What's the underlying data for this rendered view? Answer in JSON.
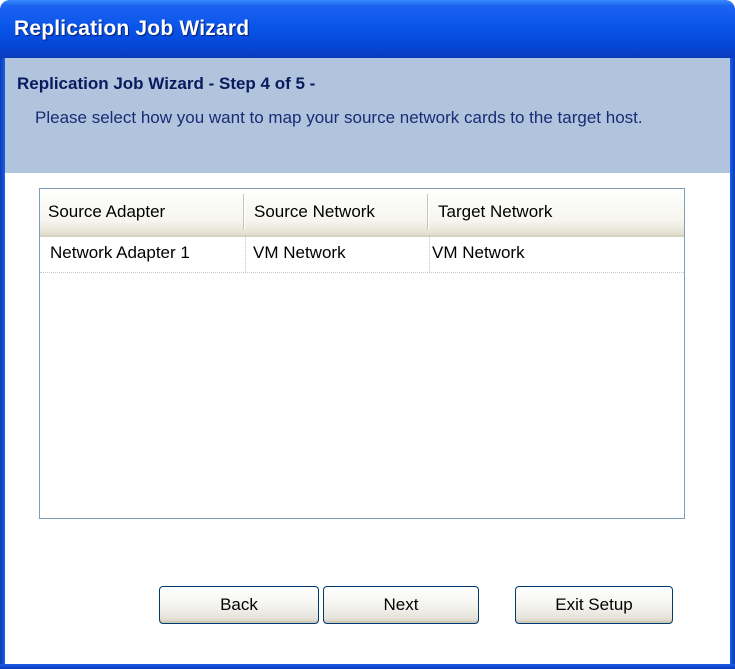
{
  "window": {
    "title": "Replication Job Wizard"
  },
  "header": {
    "step_title": "Replication Job Wizard - Step 4 of 5 -",
    "description": "Please select how you want to map your source network cards to the target host."
  },
  "table": {
    "columns": [
      "Source Adapter",
      "Source Network",
      "Target Network"
    ],
    "rows": [
      [
        "Network Adapter 1",
        "VM Network",
        "VM Network"
      ]
    ]
  },
  "buttons": {
    "back": "Back",
    "next": "Next",
    "exit": "Exit Setup"
  },
  "colors": {
    "title_bar": "#0a55ea",
    "header_panel": "#b0c4de",
    "step_title_text": "#0a1a5c"
  }
}
